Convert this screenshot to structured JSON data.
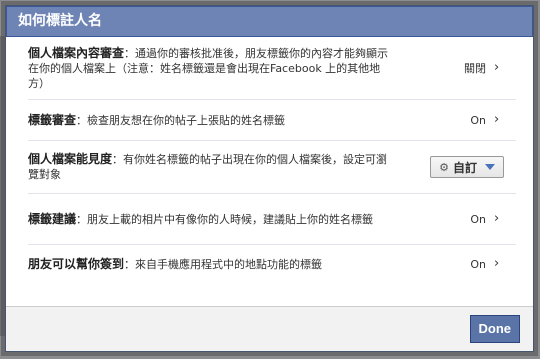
{
  "dialog": {
    "title": "如何標註人名",
    "rows": [
      {
        "label": "個人檔案內容審查",
        "desc": "：通過你的審核批准後，朋友標籤你的內容才能夠顯示在你的個人檔案上（注意：姓名標籤還是會出現在Facebook 上的其他地方）",
        "value": "關閉"
      },
      {
        "label": "標籤審查",
        "desc": "：檢查朋友想在你的帖子上張貼的姓名標籤",
        "value": "On"
      },
      {
        "label": "個人檔案能見度",
        "desc": "：有你姓名標籤的帖子出現在你的個人檔案後，設定可瀏覽對象",
        "value": "自訂"
      },
      {
        "label": "標籤建議",
        "desc": "：朋友上載的相片中有像你的人時候，建議貼上你的姓名標籤",
        "value": "On"
      },
      {
        "label": "朋友可以幫你簽到",
        "desc": "：來自手機應用程式中的地點功能的標籤",
        "value": "On"
      }
    ],
    "done_label": "Done"
  }
}
